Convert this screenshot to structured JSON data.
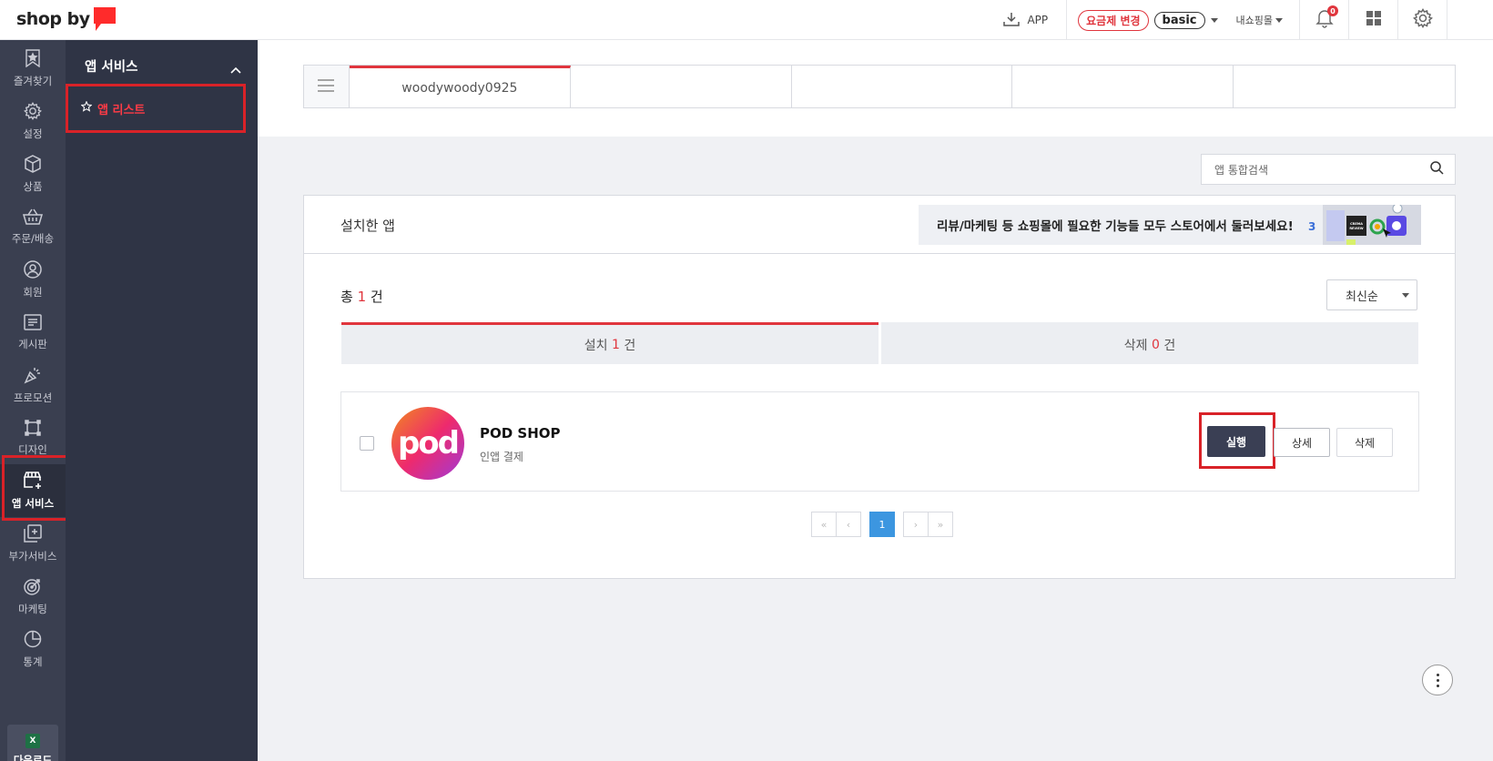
{
  "header": {
    "logo_text": "shop by",
    "app_download_label": "APP",
    "plan_change_label": "요금제 변경",
    "plan_name": "basic",
    "my_shop_label": "내쇼핑몰",
    "notification_count": "0"
  },
  "rail": {
    "items": [
      {
        "label": "즐겨찾기",
        "icon": "bookmark-star-icon"
      },
      {
        "label": "설정",
        "icon": "gear-icon"
      },
      {
        "label": "상품",
        "icon": "box-icon"
      },
      {
        "label": "주문/배송",
        "icon": "basket-icon"
      },
      {
        "label": "회원",
        "icon": "user-circle-icon"
      },
      {
        "label": "게시판",
        "icon": "board-icon"
      },
      {
        "label": "프로모션",
        "icon": "party-icon"
      },
      {
        "label": "디자인",
        "icon": "design-frame-icon"
      },
      {
        "label": "앱 서비스",
        "icon": "store-plus-icon"
      },
      {
        "label": "부가서비스",
        "icon": "copy-plus-icon"
      },
      {
        "label": "마케팅",
        "icon": "target-icon"
      },
      {
        "label": "통계",
        "icon": "pie-chart-icon"
      }
    ],
    "active_index": 8,
    "download_label": "다운로드",
    "download_icon_text": "X"
  },
  "subnav": {
    "title": "앱 서비스",
    "item_label": "앱 리스트"
  },
  "tabs": {
    "items": [
      "woodywoody0925",
      "",
      "",
      "",
      ""
    ]
  },
  "search": {
    "placeholder": "앱 통합검색"
  },
  "panel": {
    "title": "설치한 앱",
    "banner_text": "리뷰/마케팅 등 쇼핑몰에 필요한 기능들 모두 스토어에서 둘러보세요!",
    "banner_art_text": "CREMA REVIEW",
    "total_prefix": "총",
    "total_count": "1",
    "total_suffix": "건",
    "sort_label": "최신순",
    "segments": [
      {
        "prefix": "설치",
        "count": "1",
        "suffix": "건"
      },
      {
        "prefix": "삭제",
        "count": "0",
        "suffix": "건"
      }
    ],
    "active_segment": 0
  },
  "app": {
    "logo_text": "pod",
    "name": "POD SHOP",
    "description": "인앱 결제",
    "run_label": "실행",
    "detail_label": "상세",
    "delete_label": "삭제"
  },
  "pagination": {
    "first": "«",
    "prev": "‹",
    "current": "1",
    "next": "›",
    "last": "»"
  },
  "colors": {
    "accent": "#e0353d",
    "rail_bg": "#3a3f50",
    "subnav_bg": "#2f3445",
    "run_button": "#3a3f54",
    "page_active": "#3c96e0"
  }
}
